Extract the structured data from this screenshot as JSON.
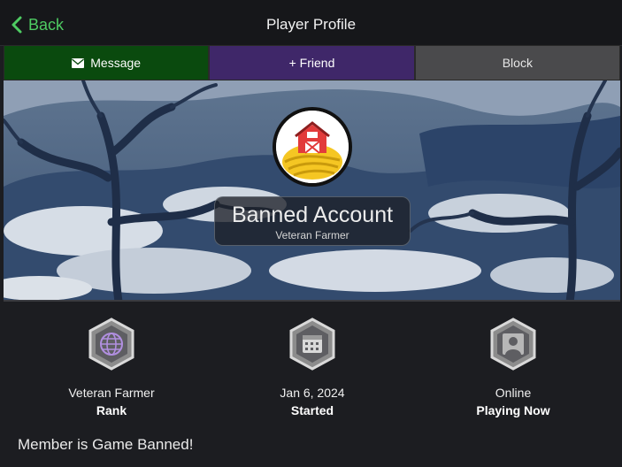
{
  "header": {
    "back_label": "Back",
    "title": "Player Profile"
  },
  "actions": {
    "message_label": "Message",
    "friend_label": "+ Friend",
    "block_label": "Block"
  },
  "profile": {
    "name": "Banned Account",
    "subtitle": "Veteran Farmer"
  },
  "stats": [
    {
      "icon": "globe-icon",
      "value": "Veteran Farmer",
      "label": "Rank"
    },
    {
      "icon": "calendar-icon",
      "value": "Jan 6, 2024",
      "label": "Started"
    },
    {
      "icon": "person-icon",
      "value": "Online",
      "label": "Playing Now"
    }
  ],
  "status_message": "Member is Game Banned!",
  "colors": {
    "accent_green": "#4ecb62",
    "message_bg": "#0a4a0e",
    "friend_bg": "#3f2769",
    "block_bg": "#4a4a4c"
  }
}
